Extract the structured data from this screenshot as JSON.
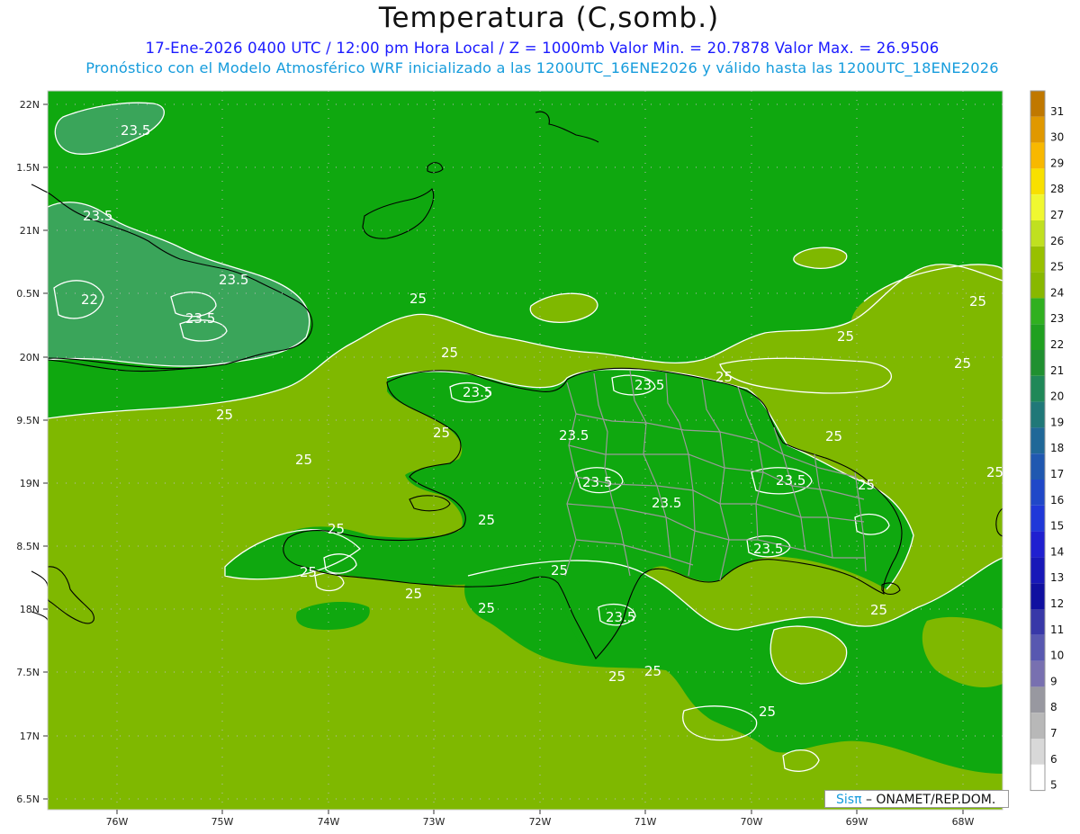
{
  "header": {
    "title": "Temperatura (C,somb.)",
    "line1": "17-Ene-2026 0400 UTC / 12:00 pm Hora Local / Z = 1000mb   Valor Min. = 20.7878  Valor Max. = 26.9506",
    "line2": "Pronóstico con el Modelo Atmosférico WRF inicializado a las 1200UTC_16ENE2026 y válido hasta las  1200UTC_18ENE2026"
  },
  "axes": {
    "lat_labels": [
      "22N",
      "1.5N",
      "21N",
      "0.5N",
      "20N",
      "9.5N",
      "19N",
      "8.5N",
      "18N",
      "7.5N",
      "17N",
      "6.5N"
    ],
    "lon_labels": [
      "76W",
      "75W",
      "74W",
      "73W",
      "72W",
      "71W",
      "70W",
      "69W",
      "68W"
    ]
  },
  "colorbar": {
    "labels": [
      "31",
      "30",
      "29",
      "28",
      "27",
      "26",
      "25",
      "24",
      "23",
      "22",
      "21",
      "20",
      "19",
      "18",
      "17",
      "16",
      "15",
      "14",
      "13",
      "12",
      "11",
      "10",
      "9",
      "8",
      "7",
      "6",
      "5"
    ],
    "colors": [
      "#c07800",
      "#e09800",
      "#f8b800",
      "#f8e000",
      "#f0f830",
      "#c0e020",
      "#98c000",
      "#88b800",
      "#30b020",
      "#20a020",
      "#209030",
      "#208858",
      "#207878",
      "#206898",
      "#2058b0",
      "#2048c8",
      "#2038d8",
      "#2020d0",
      "#1818b8",
      "#1010a0",
      "#3838a8",
      "#5858b0",
      "#7870b0",
      "#9898a0",
      "#b8b8b8",
      "#d8d8d8",
      "#ffffff"
    ]
  },
  "isotherm_labels": [
    "23.5",
    "23.5",
    "22",
    "23.5",
    "23.5",
    "25",
    "25",
    "25",
    "25",
    "25",
    "25",
    "25",
    "23.5",
    "23.5",
    "23.5",
    "25",
    "23.5",
    "25",
    "23.5",
    "23.5",
    "25",
    "23.5",
    "25",
    "25",
    "25",
    "25",
    "25",
    "25",
    "25",
    "23.5",
    "25",
    "25",
    "25",
    "25",
    "25"
  ],
  "credit": {
    "sis": "Sisπ",
    "org": " – ONAMET/REP.DOM."
  },
  "colors": {
    "sea_field": "#7fb800",
    "land_field": "#0fa80f",
    "cool_field": "#3aa55a",
    "isotherm": "#ffffff",
    "coastline": "#000000",
    "province_border": "#9a9a9a"
  }
}
